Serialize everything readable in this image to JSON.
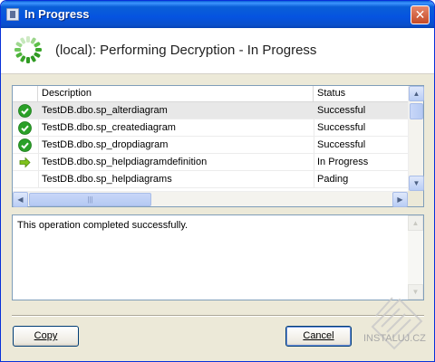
{
  "window": {
    "title": "In Progress",
    "close_glyph": "✕"
  },
  "header": {
    "text": "(local): Performing Decryption - In Progress",
    "icon": "progress-spinner-icon"
  },
  "grid": {
    "columns": [
      "Description",
      "Status"
    ],
    "rows": [
      {
        "icon": "check-icon",
        "name": "TestDB.dbo.sp_alterdiagram",
        "status": "Successful",
        "selected": true
      },
      {
        "icon": "check-icon",
        "name": "TestDB.dbo.sp_creatediagram",
        "status": "Successful"
      },
      {
        "icon": "check-icon",
        "name": "TestDB.dbo.sp_dropdiagram",
        "status": "Successful"
      },
      {
        "icon": "arrow-right-icon",
        "name": "TestDB.dbo.sp_helpdiagramdefinition",
        "status": "In Progress"
      },
      {
        "icon": "",
        "name": "TestDB.dbo.sp_helpdiagrams",
        "status": "Pading"
      }
    ]
  },
  "message": {
    "text": "This operation completed successfully."
  },
  "buttons": {
    "copy": "Copy",
    "cancel": "Cancel"
  },
  "watermark": {
    "text": "INSTALUJ.CZ"
  },
  "colors": {
    "success": "#2aa028",
    "arrow": "#7fc21c",
    "title_blue": "#0a5fd7"
  }
}
